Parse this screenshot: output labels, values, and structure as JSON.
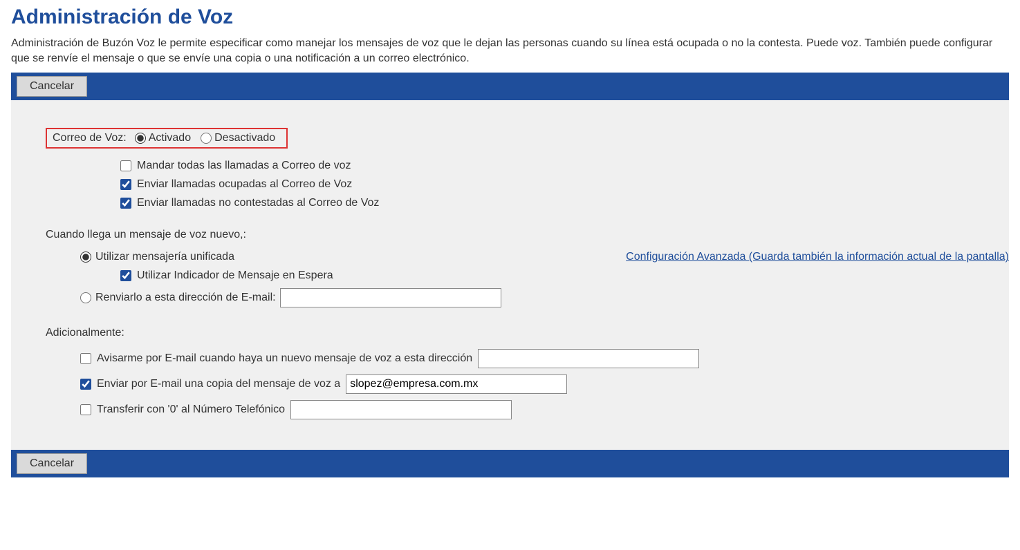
{
  "page": {
    "title": "Administración de Voz",
    "description": "Administración de Buzón Voz le permite especificar como manejar los mensajes de voz que le dejan las personas cuando su línea está ocupada o no la contesta. Puede voz. También puede configurar que se renvíe el mensaje o que se envíe una copia o una notificación a un correo electrónico."
  },
  "buttons": {
    "cancel": "Cancelar"
  },
  "voicemail_status": {
    "label": "Correo de Voz:",
    "on_label": "Activado",
    "off_label": "Desactivado"
  },
  "send_options": {
    "send_all": "Mandar todas las llamadas a Correo de voz",
    "send_busy": "Enviar llamadas ocupadas al Correo de Voz",
    "send_unanswered": "Enviar llamadas no contestadas al Correo de Voz"
  },
  "new_message": {
    "label": "Cuando llega un mensaje de voz nuevo,:",
    "unified": "Utilizar mensajería unificada",
    "waiting_indicator": "Utilizar Indicador de Mensaje en Espera",
    "forward_email_label": "Renviarlo a esta dirección de E-mail:",
    "forward_email_value": "",
    "advanced_link": "Configuración Avanzada (Guarda también la información actual de la pantalla)"
  },
  "additional": {
    "label": "Adicionalmente:",
    "notify_email_label": "Avisarme por E-mail cuando haya un nuevo mensaje de voz a esta dirección",
    "notify_email_value": "",
    "copy_email_label": "Enviar por E-mail una copia del mensaje de voz a",
    "copy_email_value": "slopez@empresa.com.mx",
    "transfer_label": "Transferir con '0' al Número Telefónico",
    "transfer_value": ""
  }
}
